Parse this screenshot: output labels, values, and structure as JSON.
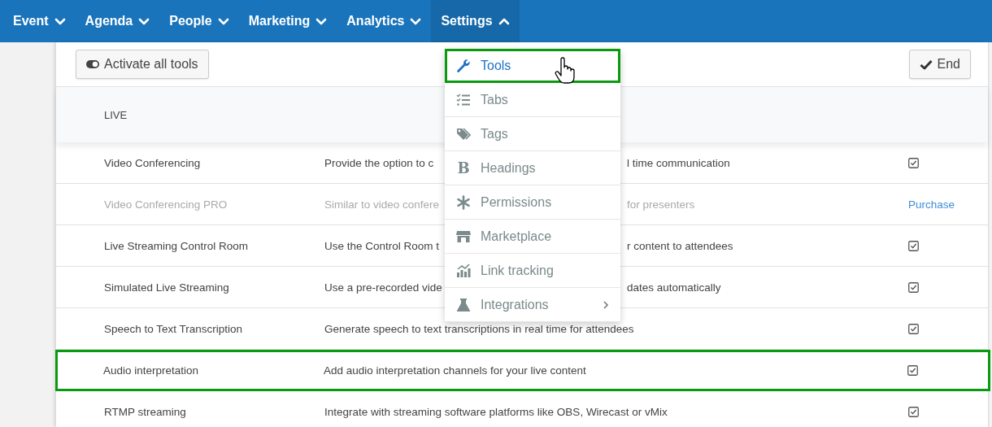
{
  "nav": [
    {
      "label": "Event",
      "expanded": false
    },
    {
      "label": "Agenda",
      "expanded": false
    },
    {
      "label": "People",
      "expanded": false
    },
    {
      "label": "Marketing",
      "expanded": false
    },
    {
      "label": "Analytics",
      "expanded": false
    },
    {
      "label": "Settings",
      "expanded": true
    }
  ],
  "toolbar": {
    "activate_button": "Activate all tools",
    "end_button": "End"
  },
  "section": {
    "title": "LIVE"
  },
  "rows": [
    {
      "name": "Video Conferencing",
      "description": "Provide the option to c",
      "description_after_menu": "l time communication",
      "disabled": false,
      "highlighted": false,
      "action": {
        "kind": "checkbox",
        "checked": true
      }
    },
    {
      "name": "Video Conferencing PRO",
      "description": "Similar to video confere",
      "description_after_menu": "for presenters",
      "disabled": true,
      "highlighted": false,
      "action": {
        "kind": "link",
        "label": "Purchase"
      }
    },
    {
      "name": "Live Streaming Control Room",
      "description": "Use the Control Room t",
      "description_after_menu": "r content to attendees",
      "disabled": false,
      "highlighted": false,
      "action": {
        "kind": "checkbox",
        "checked": true
      }
    },
    {
      "name": "Simulated Live Streaming",
      "description": "Use a pre-recorded vide",
      "description_after_menu": "dates automatically",
      "disabled": false,
      "highlighted": false,
      "action": {
        "kind": "checkbox",
        "checked": true
      }
    },
    {
      "name": "Speech to Text Transcription",
      "description": "Generate speech to text transcriptions in real time for attendees",
      "disabled": false,
      "highlighted": false,
      "action": {
        "kind": "checkbox",
        "checked": true
      }
    },
    {
      "name": "Audio interpretation",
      "description": "Add audio interpretation channels for your live content",
      "disabled": false,
      "highlighted": true,
      "action": {
        "kind": "checkbox",
        "checked": true
      }
    },
    {
      "name": "RTMP streaming",
      "description": "Integrate with streaming software platforms like OBS, Wirecast or vMix",
      "disabled": false,
      "highlighted": false,
      "action": {
        "kind": "checkbox",
        "checked": true
      }
    }
  ],
  "settings_menu": [
    {
      "label": "Tools",
      "kind": "wrench",
      "selected": true,
      "highlighted": true,
      "has_submenu": false
    },
    {
      "label": "Tabs",
      "kind": "list",
      "selected": false,
      "highlighted": false,
      "has_submenu": false
    },
    {
      "label": "Tags",
      "kind": "tag",
      "selected": false,
      "highlighted": false,
      "has_submenu": false
    },
    {
      "label": "Headings",
      "kind": "glyph",
      "icon_glyph": "B",
      "selected": false,
      "highlighted": false,
      "has_submenu": false
    },
    {
      "label": "Permissions",
      "kind": "asterisk",
      "selected": false,
      "highlighted": false,
      "has_submenu": false
    },
    {
      "label": "Marketplace",
      "kind": "store",
      "selected": false,
      "highlighted": false,
      "has_submenu": false
    },
    {
      "label": "Link tracking",
      "kind": "chart",
      "selected": false,
      "highlighted": false,
      "has_submenu": false
    },
    {
      "label": "Integrations",
      "kind": "flask",
      "selected": false,
      "highlighted": false,
      "has_submenu": true
    }
  ]
}
